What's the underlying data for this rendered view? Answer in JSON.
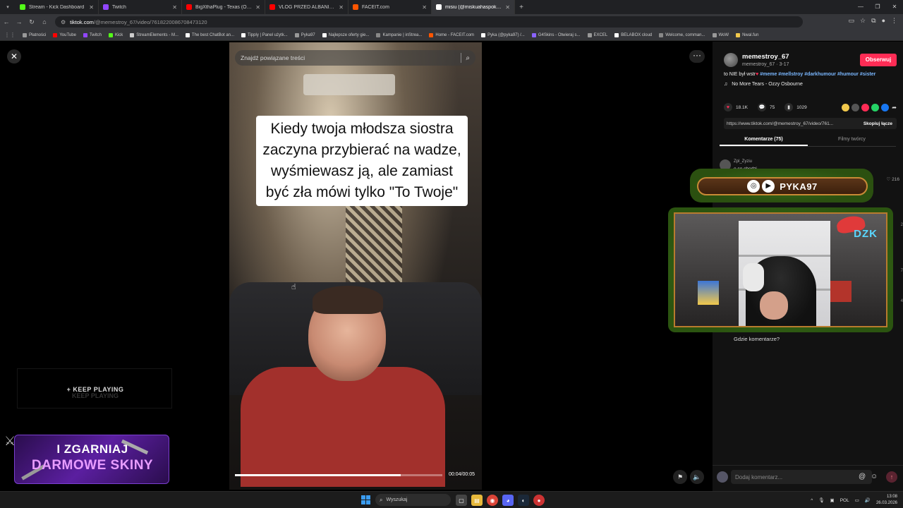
{
  "browser": {
    "tabs": [
      {
        "label": "Stream - Kick Dashboard",
        "color": "#53fc18",
        "width": 118
      },
      {
        "label": "Twitch",
        "color": "#9146ff",
        "width": 118
      },
      {
        "label": "BigXthaPlug - Texas (Official M...",
        "color": "#ff0000",
        "width": 118
      },
      {
        "label": "VLOG PRZED ALBANIA | Cały vl...",
        "color": "#ff0000",
        "width": 118
      },
      {
        "label": "FACEIT.com",
        "color": "#ff5500",
        "width": 118
      },
      {
        "label": "misiu (@miskuahaspoko) | T...",
        "color": "#ffffff",
        "width": 118,
        "active": true
      }
    ],
    "new_tab": "+",
    "url_host": "tiktok.com",
    "url_path": "/@memestroy_67/video/7618220086708473120",
    "bookmarks": [
      {
        "label": "Płatności",
        "color": "#999999"
      },
      {
        "label": "YouTube",
        "color": "#ff0000"
      },
      {
        "label": "Twitch",
        "color": "#9146ff"
      },
      {
        "label": "Kick",
        "color": "#53fc18"
      },
      {
        "label": "StreamElements - M...",
        "color": "#cccccc"
      },
      {
        "label": "The best ChatBot an...",
        "color": "#ffffff"
      },
      {
        "label": "Tipply | Panel użytk...",
        "color": "#ffffff"
      },
      {
        "label": "Pyka97",
        "color": "#999999"
      },
      {
        "label": "Najlepsze oferty gie...",
        "color": "#ffffff"
      },
      {
        "label": "Kampanie | inStrea...",
        "color": "#888888"
      },
      {
        "label": "Home - FACEIT.com",
        "color": "#ff5500"
      },
      {
        "label": "Pyka (@pyka97) /...",
        "color": "#ffffff"
      },
      {
        "label": "G4Skins - Otwieraj s...",
        "color": "#8a63ff"
      },
      {
        "label": "EXCEL",
        "color": "#999999"
      },
      {
        "label": "BELABOX cloud",
        "color": "#ffffff"
      },
      {
        "label": "Welcome, comman...",
        "color": "#888888"
      },
      {
        "label": "WoW",
        "color": "#999999"
      },
      {
        "label": "Nwal.fun",
        "color": "#f2c94c"
      }
    ]
  },
  "video": {
    "search_placeholder": "Znajdź powiązane treści",
    "caption": "Kiedy twoja młodsza siostra zaczyna przybierać na wadze, wyśmiewasz ją, ale zamiast być zła mówi tylko \"To Twoje\"",
    "time": "00:04/00:05",
    "progress_fraction": 0.8
  },
  "panel": {
    "author": "memestroy_67",
    "author_sub": "memestroy_67 · 3-17",
    "follow_label": "Obserwuj",
    "desc_text": "to NIE był wstr",
    "desc_tags": "#meme #mellstroy #darkhumour #humour #sister",
    "music": "No More Tears - Ozzy Osbourne",
    "likes": "18.1K",
    "comments": "75",
    "saves": "1029",
    "share_colors": [
      "#f2c94c",
      "#555555",
      "#fe2c55",
      "#25d366",
      "#1877f2"
    ],
    "link": "https://www.tiktok.com/@memestroy_67/video/761...",
    "copy_label": "Skopiuj łącze",
    "tab_comments": "Komentarze (75)",
    "tab_creator": "Filmy twórcy",
    "comment_user": "Zpl_Zyziu",
    "comment_text": "o co chodzi",
    "comment_likes": "216",
    "side_numbers": [
      "2",
      "7",
      "4"
    ],
    "comment_placeholder": "Dodaj komentarz..."
  },
  "overlays": {
    "keep_playing": "KEEP PLAYING",
    "promo_line1": "I ZGARNIAJ",
    "promo_line2": "DARMOWE SKINY",
    "social_name": "PYKA97",
    "webcam_logo": "DZK",
    "gdzie": "Gdzie komentarze?"
  },
  "taskbar": {
    "search": "Wyszukaj",
    "lang": "POL",
    "time": "13:08",
    "date": "26.03.2026"
  }
}
